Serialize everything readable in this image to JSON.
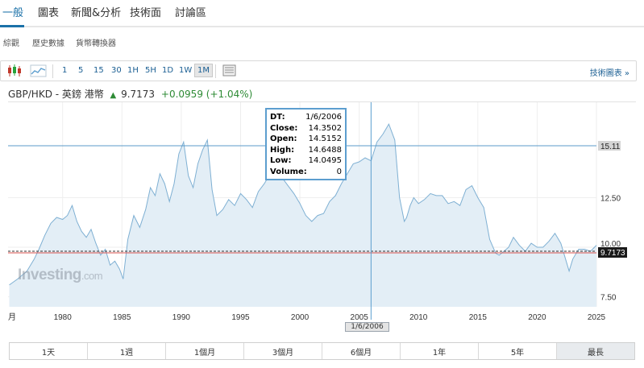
{
  "top_tabs": [
    "一般",
    "圖表",
    "新聞&分析",
    "技術面",
    "討論區"
  ],
  "sub_tabs": [
    "綜觀",
    "歷史數據",
    "貨幣轉換器"
  ],
  "toolbar": {
    "intervals": [
      "1",
      "5",
      "15",
      "30",
      "1H",
      "5H",
      "1D",
      "1W",
      "1M"
    ],
    "selected": "1M",
    "right_link": "技術圖表 »"
  },
  "instrument": {
    "name": "GBP/HKD - 英鎊 港幣",
    "price": "9.7173",
    "change": "+0.0959 (+1.04%)"
  },
  "tooltip": {
    "rows": [
      {
        "k": "DT:",
        "v": "1/6/2006"
      },
      {
        "k": "Close:",
        "v": "14.3502"
      },
      {
        "k": "Open:",
        "v": "14.5152"
      },
      {
        "k": "High:",
        "v": "14.6488"
      },
      {
        "k": "Low:",
        "v": "14.0495"
      },
      {
        "k": "Volume:",
        "v": "0"
      }
    ]
  },
  "crosshair_date": "1/6/2006",
  "watermark": {
    "brand": "Investing",
    "suffix": ".com"
  },
  "periods": [
    "1天",
    "1週",
    "1個月",
    "3個月",
    "6個月",
    "1年",
    "5年",
    "最長"
  ],
  "chart_data": {
    "type": "area",
    "x_ticks": [
      "1980",
      "1985",
      "1990",
      "1995",
      "2000",
      "2005",
      "2010",
      "2015",
      "2020",
      "2025"
    ],
    "left_cut_label": "月",
    "y_ticks": [
      "7.50",
      "10.00",
      "12.50"
    ],
    "ylim": [
      7.0,
      17.3
    ],
    "xlim": [
      1975.4,
      2025.0
    ],
    "hline_value": 15.11,
    "hline_label": "15.11",
    "last_value": 9.7173,
    "last_label": "9.7173",
    "colors": {
      "line": "#7fb0d3",
      "fill": "#e3eef6",
      "hline": "#5b9bc9",
      "last": "#d9534f",
      "label_bg": "#d4d4d4",
      "last_bg": "#1a1a1a"
    },
    "series": [
      {
        "x": [
          1975.5,
          1976.2,
          1977.0,
          1977.6,
          1978.0,
          1978.5,
          1979.0,
          1979.5,
          1980.0,
          1980.4,
          1980.8,
          1981.2,
          1981.6,
          1982.0,
          1982.4,
          1982.8,
          1983.2,
          1983.6,
          1984.0,
          1984.4,
          1984.8,
          1985.1,
          1985.5,
          1986.0,
          1986.5,
          1987.0,
          1987.4,
          1987.8,
          1988.2,
          1988.6,
          1989.0,
          1989.4,
          1989.8,
          1990.2,
          1990.6,
          1991.0,
          1991.4,
          1991.8,
          1992.2,
          1992.6,
          1993.0,
          1993.5,
          1994.0,
          1994.5,
          1995.0,
          1995.5,
          1996.0,
          1996.5,
          1997.0,
          1997.5,
          1998.0,
          1998.5,
          1999.0,
          1999.5,
          2000.0,
          2000.5,
          2001.0,
          2001.5,
          2002.0,
          2002.5,
          2003.0,
          2003.5,
          2004.0,
          2004.5,
          2005.0,
          2005.5,
          2006.0,
          2006.5,
          2007.0,
          2007.5,
          2008.0,
          2008.4,
          2008.8,
          2009.0,
          2009.3,
          2009.6,
          2010.0,
          2010.5,
          2011.0,
          2011.5,
          2012.0,
          2012.5,
          2013.0,
          2013.5,
          2014.0,
          2014.5,
          2015.0,
          2015.5,
          2016.0,
          2016.5,
          2016.8,
          2017.2,
          2017.6,
          2018.0,
          2018.5,
          2019.0,
          2019.5,
          2020.0,
          2020.5,
          2021.0,
          2021.5,
          2022.0,
          2022.4,
          2022.7,
          2023.0,
          2023.5,
          2024.0,
          2024.5,
          2025.0
        ],
        "values": [
          8.1,
          8.4,
          8.8,
          9.4,
          9.9,
          10.6,
          11.2,
          11.5,
          11.4,
          11.6,
          12.1,
          11.3,
          10.8,
          10.5,
          10.9,
          10.2,
          9.6,
          9.9,
          9.1,
          9.3,
          8.9,
          8.4,
          10.4,
          11.6,
          11.0,
          11.9,
          13.0,
          12.6,
          13.7,
          13.2,
          12.3,
          13.2,
          14.7,
          15.3,
          13.6,
          13.0,
          14.2,
          14.9,
          15.4,
          12.9,
          11.6,
          11.9,
          12.4,
          12.1,
          12.7,
          12.4,
          12.0,
          12.8,
          13.2,
          13.7,
          13.6,
          13.5,
          13.1,
          12.7,
          12.2,
          11.6,
          11.3,
          11.6,
          11.7,
          12.3,
          12.6,
          13.2,
          13.7,
          14.2,
          14.3,
          14.5,
          14.35,
          15.3,
          15.7,
          16.2,
          15.4,
          12.5,
          11.3,
          11.5,
          12.1,
          12.5,
          12.2,
          12.4,
          12.7,
          12.6,
          12.6,
          12.2,
          12.3,
          12.1,
          12.9,
          13.1,
          12.5,
          12.0,
          10.4,
          9.7,
          9.6,
          9.8,
          10.0,
          10.5,
          10.1,
          9.8,
          10.2,
          10.0,
          10.0,
          10.3,
          10.7,
          10.2,
          9.4,
          8.8,
          9.4,
          9.9,
          9.9,
          9.8,
          10.1
        ]
      }
    ]
  }
}
